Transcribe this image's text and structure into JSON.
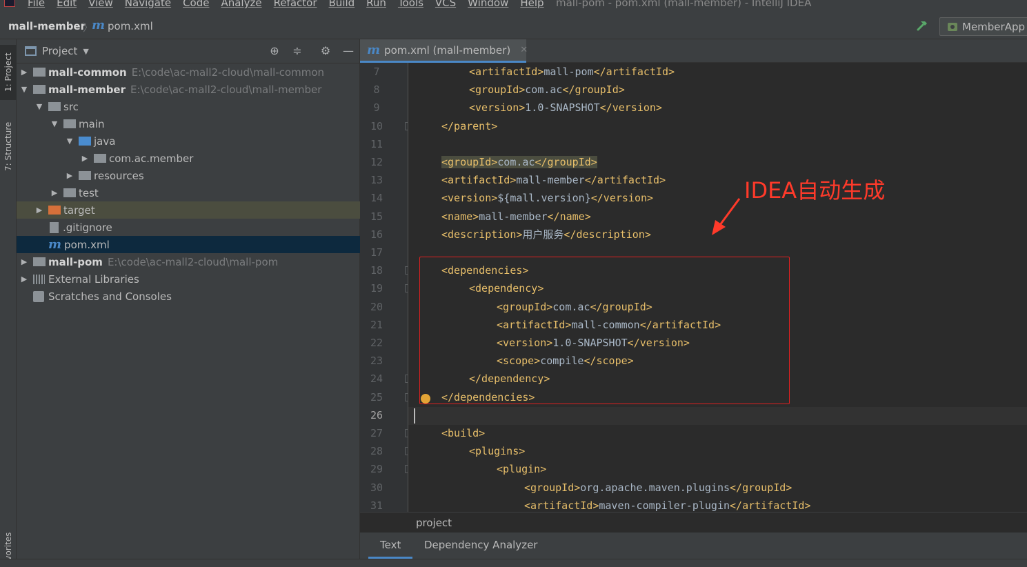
{
  "window": {
    "title": "mall-pom - pom.xml (mall-member) - IntelliJ IDEA",
    "menu": [
      "File",
      "Edit",
      "View",
      "Navigate",
      "Code",
      "Analyze",
      "Refactor",
      "Build",
      "Run",
      "Tools",
      "VCS",
      "Window",
      "Help"
    ]
  },
  "navbar": {
    "project": "mall-member",
    "file_icon": "m",
    "file": "pom.xml",
    "run_config": "MemberApp"
  },
  "tool_stripe": {
    "project_tab": "1: Project",
    "structure_tab": "7: Structure",
    "favorites_tab": "avorites"
  },
  "project_panel": {
    "title": "Project",
    "tree": [
      {
        "label": "mall-common",
        "path": "E:\\code\\ac-mall2-cloud\\mall-common",
        "arrow": "▶",
        "indent": 0,
        "icon": "gray",
        "bold": true
      },
      {
        "label": "mall-member",
        "path": "E:\\code\\ac-mall2-cloud\\mall-member",
        "arrow": "▼",
        "indent": 0,
        "icon": "gray",
        "bold": true
      },
      {
        "label": "src",
        "arrow": "▼",
        "indent": 1,
        "icon": "gray"
      },
      {
        "label": "main",
        "arrow": "▼",
        "indent": 2,
        "icon": "gray"
      },
      {
        "label": "java",
        "arrow": "▼",
        "indent": 3,
        "icon": "blue"
      },
      {
        "label": "com.ac.member",
        "arrow": "▶",
        "indent": 4,
        "icon": "gray"
      },
      {
        "label": "resources",
        "arrow": "▶",
        "indent": 3,
        "icon": "gray"
      },
      {
        "label": "test",
        "arrow": "▶",
        "indent": 2,
        "icon": "gray"
      },
      {
        "label": "target",
        "arrow": "▶",
        "indent": 1,
        "icon": "orange"
      },
      {
        "label": ".gitignore",
        "arrow": "",
        "indent": 1,
        "icon": "file"
      },
      {
        "label": "pom.xml",
        "arrow": "",
        "indent": 1,
        "icon": "maven"
      },
      {
        "label": "mall-pom",
        "path": "E:\\code\\ac-mall2-cloud\\mall-pom",
        "arrow": "▶",
        "indent": 0,
        "icon": "gray",
        "bold": true
      },
      {
        "label": "External Libraries",
        "arrow": "▶",
        "indent": 0,
        "icon": "lib"
      },
      {
        "label": "Scratches and Consoles",
        "arrow": "",
        "indent": 0,
        "icon": "scratch"
      }
    ]
  },
  "editor": {
    "tab_label": "pom.xml (mall-member)",
    "lines": [
      {
        "n": "7",
        "indent": 2,
        "parts": [
          [
            "tag",
            "<artifactId>"
          ],
          [
            "txt",
            "mall-pom"
          ],
          [
            "tag",
            "</artifactId>"
          ]
        ]
      },
      {
        "n": "8",
        "indent": 2,
        "parts": [
          [
            "tag",
            "<groupId>"
          ],
          [
            "txt",
            "com.ac"
          ],
          [
            "tag",
            "</groupId>"
          ]
        ]
      },
      {
        "n": "9",
        "indent": 2,
        "parts": [
          [
            "tag",
            "<version>"
          ],
          [
            "txt",
            "1.0-SNAPSHOT"
          ],
          [
            "tag",
            "</version>"
          ]
        ]
      },
      {
        "n": "10",
        "indent": 1,
        "parts": [
          [
            "tag",
            "</parent>"
          ]
        ]
      },
      {
        "n": "11",
        "indent": 0,
        "parts": []
      },
      {
        "n": "12",
        "indent": 1,
        "parts": [
          [
            "tag",
            "<groupId>"
          ],
          [
            "txt",
            "com.ac"
          ],
          [
            "tag",
            "</groupId>"
          ]
        ],
        "hl": true
      },
      {
        "n": "13",
        "indent": 1,
        "parts": [
          [
            "tag",
            "<artifactId>"
          ],
          [
            "txt",
            "mall-member"
          ],
          [
            "tag",
            "</artifactId>"
          ]
        ]
      },
      {
        "n": "14",
        "indent": 1,
        "parts": [
          [
            "tag",
            "<version>"
          ],
          [
            "txt",
            "${mall.version}"
          ],
          [
            "tag",
            "</version>"
          ]
        ]
      },
      {
        "n": "15",
        "indent": 1,
        "parts": [
          [
            "tag",
            "<name>"
          ],
          [
            "txt",
            "mall-member"
          ],
          [
            "tag",
            "</name>"
          ]
        ]
      },
      {
        "n": "16",
        "indent": 1,
        "parts": [
          [
            "tag",
            "<description>"
          ],
          [
            "txt",
            "用户服务"
          ],
          [
            "tag",
            "</description>"
          ]
        ]
      },
      {
        "n": "17",
        "indent": 0,
        "parts": []
      },
      {
        "n": "18",
        "indent": 1,
        "parts": [
          [
            "tag",
            "<dependencies>"
          ]
        ]
      },
      {
        "n": "19",
        "indent": 2,
        "parts": [
          [
            "tag",
            "<dependency>"
          ]
        ]
      },
      {
        "n": "20",
        "indent": 3,
        "parts": [
          [
            "tag",
            "<groupId>"
          ],
          [
            "txt",
            "com.ac"
          ],
          [
            "tag",
            "</groupId>"
          ]
        ]
      },
      {
        "n": "21",
        "indent": 3,
        "parts": [
          [
            "tag",
            "<artifactId>"
          ],
          [
            "txt",
            "mall-common"
          ],
          [
            "tag",
            "</artifactId>"
          ]
        ]
      },
      {
        "n": "22",
        "indent": 3,
        "parts": [
          [
            "tag",
            "<version>"
          ],
          [
            "txt",
            "1.0-SNAPSHOT"
          ],
          [
            "tag",
            "</version>"
          ]
        ]
      },
      {
        "n": "23",
        "indent": 3,
        "parts": [
          [
            "tag",
            "<scope>"
          ],
          [
            "txt",
            "compile"
          ],
          [
            "tag",
            "</scope>"
          ]
        ]
      },
      {
        "n": "24",
        "indent": 2,
        "parts": [
          [
            "tag",
            "</dependency>"
          ]
        ]
      },
      {
        "n": "25",
        "indent": 1,
        "parts": [
          [
            "tag",
            "</dependencies>"
          ]
        ]
      },
      {
        "n": "26",
        "indent": 0,
        "parts": [],
        "current": true
      },
      {
        "n": "27",
        "indent": 1,
        "parts": [
          [
            "tag",
            "<build>"
          ]
        ]
      },
      {
        "n": "28",
        "indent": 2,
        "parts": [
          [
            "tag",
            "<plugins>"
          ]
        ]
      },
      {
        "n": "29",
        "indent": 3,
        "parts": [
          [
            "tag",
            "<plugin>"
          ]
        ]
      },
      {
        "n": "30",
        "indent": 4,
        "parts": [
          [
            "tag",
            "<groupId>"
          ],
          [
            "txt",
            "org.apache.maven.plugins"
          ],
          [
            "tag",
            "</groupId>"
          ]
        ]
      },
      {
        "n": "31",
        "indent": 4,
        "parts": [
          [
            "tag",
            "<artifactId>"
          ],
          [
            "txt",
            "maven-compiler-plugin"
          ],
          [
            "tag",
            "</artifactId>"
          ]
        ]
      }
    ],
    "fold_lines": [
      "10",
      "18",
      "19",
      "24",
      "25",
      "27",
      "28",
      "29"
    ],
    "annotation": "IDEA自动生成",
    "annotation_color": "#ff3a2a",
    "breadcrumb": "project"
  },
  "bottom_tabs": {
    "text": "Text",
    "dependency": "Dependency Analyzer"
  },
  "colors": {
    "tag": "#e8bf6a",
    "text": "#a9b7c6",
    "selection": "#0d293e",
    "accent": "#4a88c7"
  }
}
